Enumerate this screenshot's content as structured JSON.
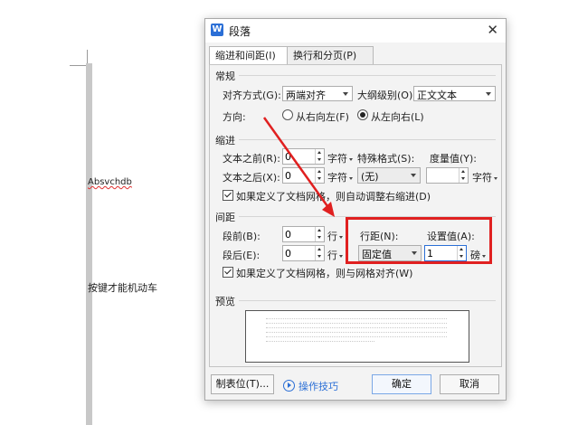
{
  "document": {
    "line1": "Absvchdb",
    "line2": "按键才能机动车"
  },
  "dialog": {
    "title": "段落",
    "app_icon": "W",
    "close_icon": "close-icon",
    "tabs": [
      {
        "label": "缩进和间距(I)",
        "active": true
      },
      {
        "label": "换行和分页(P)",
        "active": false
      }
    ],
    "general": {
      "title": "常规",
      "alignment_label": "对齐方式(G):",
      "alignment_value": "两端对齐",
      "outline_label": "大纲级别(O):",
      "outline_value": "正文文本",
      "direction_label": "方向:",
      "rtl_label": "从右向左(F)",
      "ltr_label": "从左向右(L)",
      "direction_selected": "ltr"
    },
    "indent": {
      "title": "缩进",
      "before_label": "文本之前(R):",
      "before_value": "0",
      "before_unit": "字符",
      "after_label": "文本之后(X):",
      "after_value": "0",
      "after_unit": "字符",
      "special_label": "特殊格式(S):",
      "special_value": "(无)",
      "measure_label": "度量值(Y):",
      "measure_value": "",
      "measure_unit": "字符",
      "auto_adjust_label": "如果定义了文档网格，则自动调整右缩进(D)",
      "auto_adjust_checked": true
    },
    "spacing": {
      "title": "间距",
      "before_label": "段前(B):",
      "before_value": "0",
      "before_unit": "行",
      "after_label": "段后(E):",
      "after_value": "0",
      "after_unit": "行",
      "line_spacing_label": "行距(N):",
      "line_spacing_value": "固定值",
      "set_value_label": "设置值(A):",
      "set_value": "1",
      "set_value_unit": "磅",
      "snap_grid_label": "如果定义了文档网格，则与网格对齐(W)",
      "snap_grid_checked": true
    },
    "preview": {
      "title": "预览",
      "lines": [
        "前一段落前一段落前一段落前一段落前一段落前一段落前一段落前一段落",
        "前一段落前一段落前一段落前一段落前一段落前一段落前一段落前一段落",
        "段落前一段落前一段落前一段落前一段落前一段落前一段落前一段落前一",
        "段落前一段落前一段落前一段落前一段落前一段落前一段落前一段落前一",
        "段落前一段落前一段落前一段落前一段落前一段落前一段落前一段落前一"
      ]
    },
    "buttons": {
      "tabs": "制表位(T)...",
      "tips": "操作技巧",
      "ok": "确定",
      "cancel": "取消"
    }
  },
  "annotation": {
    "highlight_color": "#e02020"
  }
}
